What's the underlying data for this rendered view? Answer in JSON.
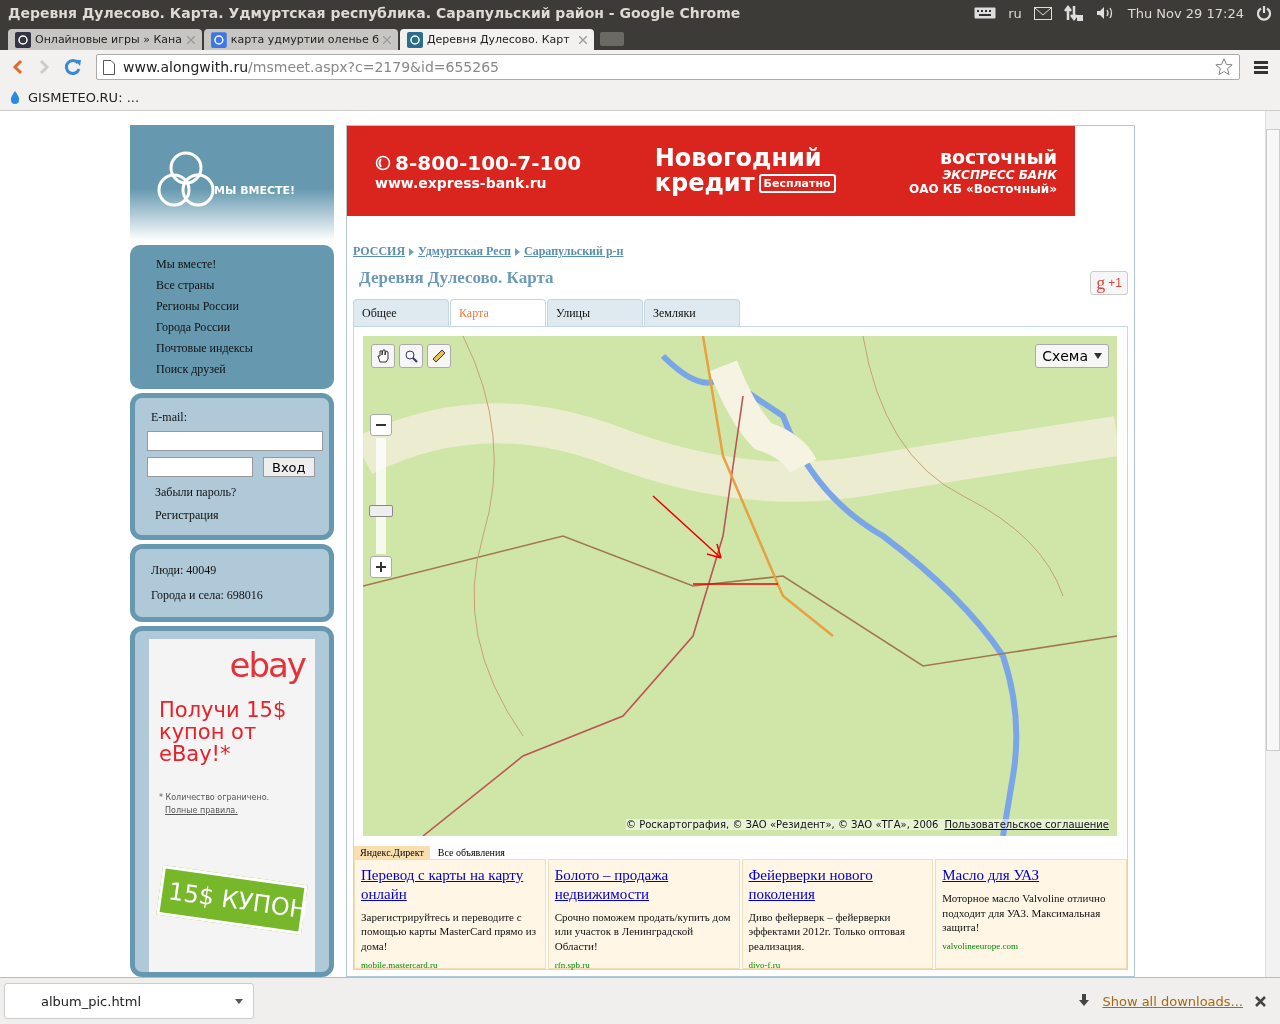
{
  "os_bar": {
    "title": "Деревня Дулесово. Карта. Удмуртская республика. Сарапульский район - Google Chrome",
    "keyboard": "ru",
    "clock": "Thu Nov 29  17:24"
  },
  "browser_tabs": [
    {
      "title": "Онлайновые игры » Кана",
      "selected": false
    },
    {
      "title": "карта удмуртии оленье б",
      "selected": false
    },
    {
      "title": "Деревня Дулесово. Карт",
      "selected": true
    }
  ],
  "address": {
    "host": "www.alongwith.ru",
    "path": "/msmeet.aspx?c=2179&id=655265"
  },
  "bookmarks": [
    "GISMETEO.RU: ..."
  ],
  "logo": {
    "text": "МЫ ВМЕСТЕ!"
  },
  "nav": [
    "Мы вместе!",
    "Все страны",
    "Регионы России",
    "Города России",
    "Почтовые индексы",
    "Поиск друзей"
  ],
  "login": {
    "email_label": "E-mail:",
    "button": "Вход",
    "links": [
      "Забыли пароль?",
      "Регистрация"
    ]
  },
  "stats": [
    "Люди: 40049",
    "Города и села: 698016"
  ],
  "ebay_ad": {
    "logo": "ebay",
    "headline": "Получи 15$ купон от eBay!*",
    "note": "* Количество ограничено.",
    "rules": "Полные правила.",
    "coupon": "15$ КУПОН"
  },
  "bank_ad": {
    "phone": "8-800-100-7-100",
    "site": "www.express-bank.ru",
    "title1": "Новогодний",
    "title2": "кредит",
    "badge": "Бесплатно",
    "brand": "восточный",
    "brand_sub": "ЭКСПРЕСС БАНК",
    "company": "ОАО КБ «Восточный»"
  },
  "breadcrumbs": [
    "РОССИЯ",
    "Удмуртская Респ",
    "Сарапульский р-н"
  ],
  "page_title": "Деревня Дулесово. Карта",
  "plus_one": {
    "logo": "g",
    "label": "+1"
  },
  "page_tabs": [
    {
      "label": "Общее",
      "selected": false
    },
    {
      "label": "Карта",
      "selected": true
    },
    {
      "label": "Улицы",
      "selected": false
    },
    {
      "label": "Земляки",
      "selected": false
    }
  ],
  "map": {
    "layer_button": "Схема",
    "zoom": {
      "level": 0.36
    },
    "copyright": "© Роскартография, © ЗАО «Резидент», © ЗАО «ТГА», 2006",
    "agreement": "Пользовательское соглашение"
  },
  "direct": {
    "label": "Яндекс.Директ",
    "all": "Все объявления",
    "ads": [
      {
        "title": "Перевод с карты на карту онлайн",
        "text": "Зарегистрируйтесь и переводите с помощью карты MasterCard прямо из дома!",
        "domain": "mobile.mastercard.ru"
      },
      {
        "title": "Болото – продажа недвижимости",
        "text": "Срочно поможем продать/купить дом или участок в Ленинградской Области!",
        "domain": "rfn.spb.ru"
      },
      {
        "title": "Фейерверки нового поколения",
        "text": "Диво фейерверк – фейерверки эффектами 2012г. Только оптовая реализация.",
        "domain": "divo-f.ru"
      },
      {
        "title": "Масло для УАЗ",
        "text": "Моторное масло Valvoline отлично подходит для УАЗ. Максимальная защита!",
        "domain": "valvolineeurope.com"
      }
    ]
  },
  "downloads": {
    "file": "album_pic.html",
    "show_all": "Show all downloads..."
  }
}
